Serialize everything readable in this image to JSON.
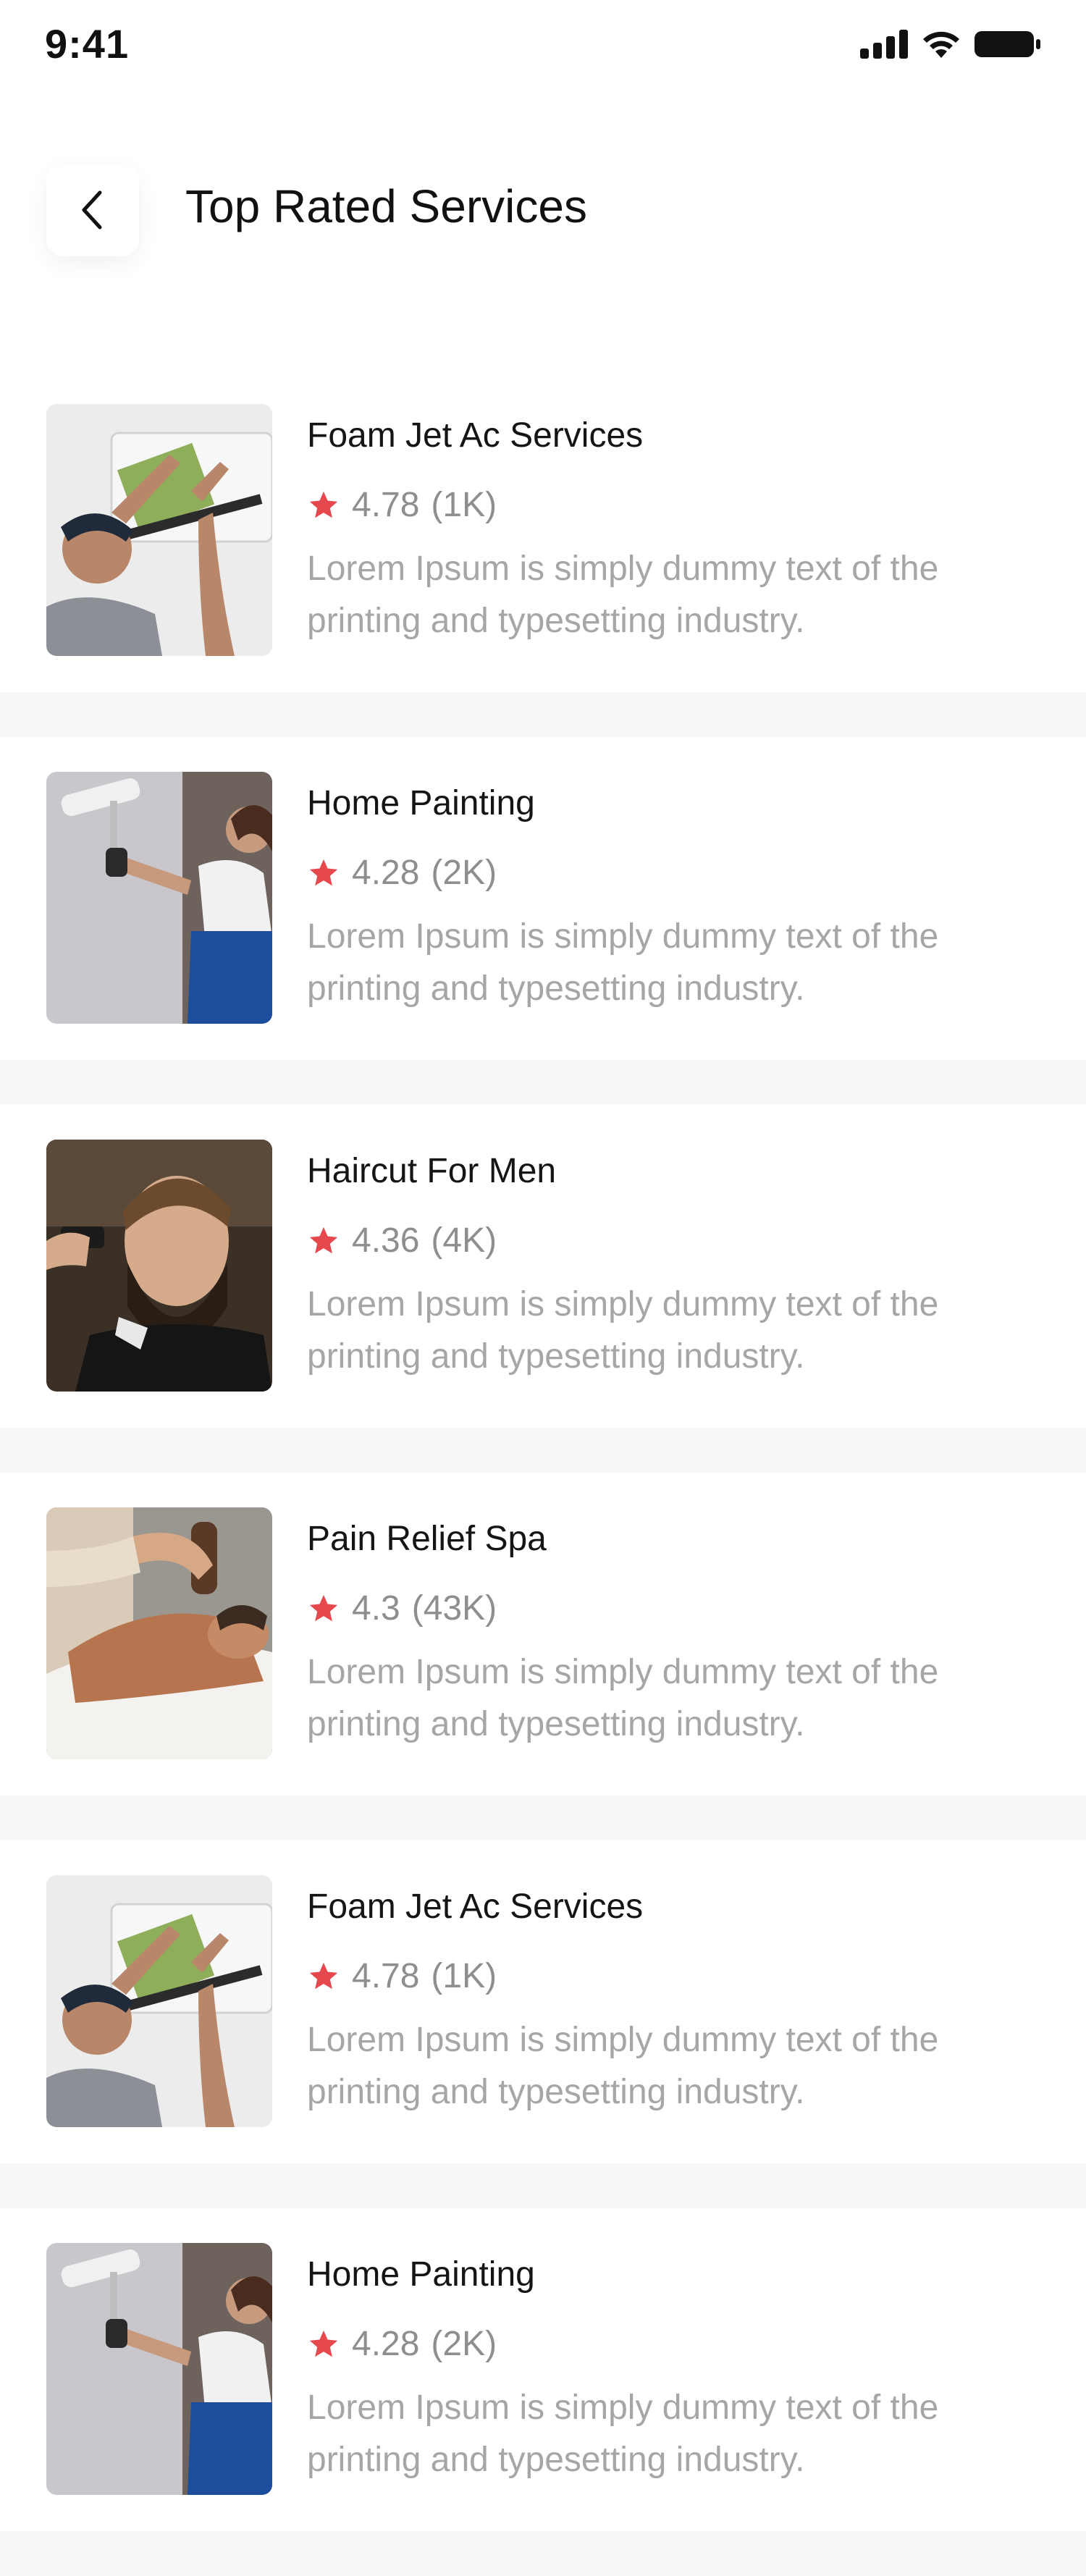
{
  "status_bar": {
    "time": "9:41"
  },
  "header": {
    "title": "Top Rated Services"
  },
  "services": [
    {
      "title": "Foam Jet Ac Services",
      "rating": "4.78",
      "count": "(1K)",
      "desc": "Lorem Ipsum is simply dummy text of the printing and typesetting industry.",
      "image": "ac-technician"
    },
    {
      "title": "Home Painting",
      "rating": "4.28",
      "count": "(2K)",
      "desc": "Lorem Ipsum is simply dummy text of the printing and typesetting industry.",
      "image": "painter-woman"
    },
    {
      "title": "Haircut For Men",
      "rating": "4.36",
      "count": "(4K)",
      "desc": "Lorem Ipsum is simply dummy text of the printing and typesetting industry.",
      "image": "bearded-man-haircut"
    },
    {
      "title": "Pain Relief Spa",
      "rating": "4.3",
      "count": "(43K)",
      "desc": "Lorem Ipsum is simply dummy text of the printing and typesetting industry.",
      "image": "massage-spa"
    },
    {
      "title": "Foam Jet Ac Services",
      "rating": "4.78",
      "count": "(1K)",
      "desc": "Lorem Ipsum is simply dummy text of the printing and typesetting industry.",
      "image": "ac-technician"
    },
    {
      "title": "Home Painting",
      "rating": "4.28",
      "count": "(2K)",
      "desc": "Lorem Ipsum is simply dummy text of the printing and typesetting industry.",
      "image": "painter-woman"
    }
  ],
  "colors": {
    "star": "#e5484d",
    "muted": "#8e8e8e",
    "light": "#a6a6a6"
  }
}
